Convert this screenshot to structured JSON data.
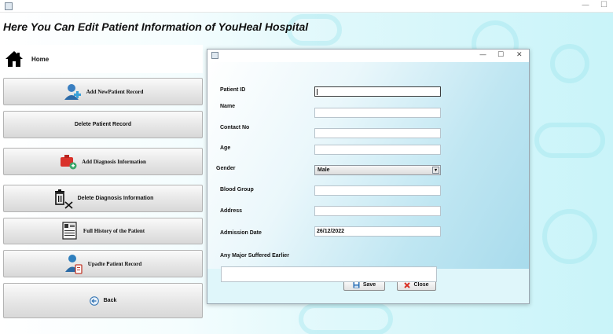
{
  "window": {
    "minimize_glyph": "—",
    "maximize_glyph": "☐"
  },
  "page": {
    "title": "Here You Can Edit Patient Information of YouHeal Hospital"
  },
  "sidebar": {
    "home_label": "Home",
    "buttons": [
      {
        "label": "Add NewPatient Record",
        "icon": "add-patient-icon"
      },
      {
        "label": "Delete Patient Record",
        "icon": ""
      },
      {
        "label": "Add Diagnosis Information",
        "icon": "add-diagnosis-icon"
      },
      {
        "label": "Delete Diagnosis Information",
        "icon": "delete-bin-icon"
      },
      {
        "label": "Full History of the Patient",
        "icon": "history-icon"
      },
      {
        "label": "Upadte Patient Record",
        "icon": "update-patient-icon"
      },
      {
        "label": "Back",
        "icon": "back-arrow-icon"
      }
    ]
  },
  "dialog": {
    "minimize_glyph": "—",
    "maximize_glyph": "☐",
    "close_glyph": "✕",
    "fields": {
      "patient_id": {
        "label": "Patient ID",
        "value": ""
      },
      "name": {
        "label": "Name",
        "value": ""
      },
      "contact_no": {
        "label": "Contact No",
        "value": ""
      },
      "age": {
        "label": "Age",
        "value": ""
      },
      "gender": {
        "label": "Gender",
        "value": "Male",
        "arrow": "▾"
      },
      "blood_group": {
        "label": "Blood Group",
        "value": ""
      },
      "address": {
        "label": "Address",
        "value": ""
      },
      "admission_date": {
        "label": "Admission Date",
        "value": "26/12/2022"
      },
      "major_suffered": {
        "label": "Any  Major Suffered Earlier",
        "value": ""
      }
    },
    "save_label": "Save",
    "close_label": "Close"
  },
  "colors": {
    "background_accent": "#c9f4f9",
    "close_icon": "#d93025",
    "save_icon": "#2a6fb5"
  }
}
